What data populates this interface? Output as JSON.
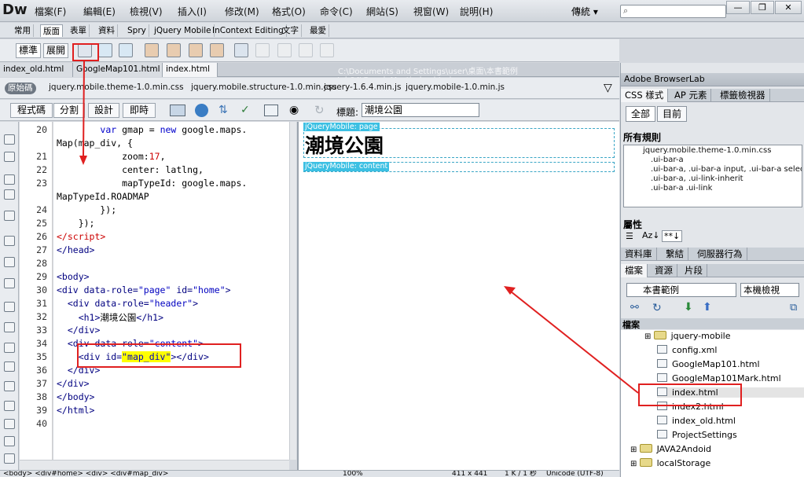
{
  "app": {
    "logo": "Dw",
    "layout": "傳統 ▾",
    "search_placeholder": ""
  },
  "menu": [
    "檔案(F)",
    "編輯(E)",
    "檢視(V)",
    "插入(I)",
    "修改(M)",
    "格式(O)",
    "命令(C)",
    "網站(S)",
    "視窗(W)",
    "說明(H)"
  ],
  "window_controls": [
    "—",
    "❐",
    "✕"
  ],
  "insert_tabs": [
    "常用",
    "版面",
    "表單",
    "資料",
    "Spry",
    "jQuery Mobile",
    "InContext Editing",
    "文字",
    "最愛"
  ],
  "insert_active": "版面",
  "layout_modes": [
    "標準",
    "展開"
  ],
  "doc_tabs": [
    "index_old.html",
    "GoogleMap101.html",
    "index.html"
  ],
  "doc_path": "C:\\Documents and Settings\\user\\桌面\\本書範例\\ch04\\GoogleMap\\index.html",
  "related": {
    "source_label": "原始碼",
    "files": [
      "jquery.mobile.theme-1.0.min.css",
      "jquery.mobile.structure-1.0.min.css",
      "jquery-1.6.4.min.js",
      "jquery.mobile-1.0.min.js"
    ]
  },
  "view_buttons": [
    "程式碼",
    "分割",
    "設計",
    "即時"
  ],
  "title_label": "標題:",
  "page_title": "潮境公園",
  "code_lines": [
    {
      "n": "20",
      "html": "        <span class='kw'>var</span> gmap = <span class='kw'>new</span> google.maps."
    },
    {
      "n": "",
      "html": "Map(map_div, {"
    },
    {
      "n": "21",
      "html": "            zoom:<span class='nm'>17</span>,"
    },
    {
      "n": "22",
      "html": "            center: latlng,"
    },
    {
      "n": "23",
      "html": "            mapTypeId: google.maps."
    },
    {
      "n": "",
      "html": "MapTypeId.ROADMAP"
    },
    {
      "n": "24",
      "html": "        });"
    },
    {
      "n": "25",
      "html": "    });"
    },
    {
      "n": "26",
      "html": "<span class='nm'>&lt;/script&gt;</span>"
    },
    {
      "n": "27",
      "html": "<span class='tg'>&lt;/head&gt;</span>"
    },
    {
      "n": "28",
      "html": ""
    },
    {
      "n": "29",
      "html": "<span class='tg'>&lt;body&gt;</span>"
    },
    {
      "n": "30",
      "html": "<span class='tg'>&lt;div data-role=</span><span class='st'>\"page\"</span><span class='tg'> id=</span><span class='st'>\"home\"</span><span class='tg'>&gt;</span>"
    },
    {
      "n": "31",
      "html": "  <span class='tg'>&lt;div data-role=</span><span class='st'>\"header\"</span><span class='tg'>&gt;</span>"
    },
    {
      "n": "32",
      "html": "    <span class='tg'>&lt;h1&gt;</span>潮境公園<span class='tg'>&lt;/h1&gt;</span>"
    },
    {
      "n": "33",
      "html": "  <span class='tg'>&lt;/div&gt;</span>"
    },
    {
      "n": "34",
      "html": "  <span class='tg'>&lt;div data-role=</span><span class='st'>\"content\"</span><span class='tg'>&gt;</span>"
    },
    {
      "n": "35",
      "html": "    <span class='tg'>&lt;div id=</span><span class='st' style='background:#ffff00'>\"map_div\"</span><span class='tg'>&gt;&lt;/div&gt;</span>"
    },
    {
      "n": "36",
      "html": "  <span class='tg'>&lt;/div&gt;</span>"
    },
    {
      "n": "37",
      "html": "<span class='tg'>&lt;/div&gt;</span>"
    },
    {
      "n": "38",
      "html": "<span class='tg'>&lt;/body&gt;</span>"
    },
    {
      "n": "39",
      "html": "<span class='tg'>&lt;/html&gt;</span>"
    },
    {
      "n": "40",
      "html": ""
    }
  ],
  "design": {
    "page_label": "jQueryMobile: page",
    "heading": "潮境公園",
    "content_label": "jQueryMobile: content"
  },
  "status": {
    "path": "<body> <div#home> <div> <div#map_div>",
    "zoom": "100%",
    "size": "411 x 441",
    "dl": "1 K / 1 秒",
    "enc": "Unicode (UTF-8)"
  },
  "panels": {
    "browserlab": "Adobe BrowserLab",
    "css_tabs": [
      "CSS 樣式",
      "AP 元素",
      "標籤檢視器"
    ],
    "mode_buttons": [
      "全部",
      "目前"
    ],
    "rules_title": "所有規則",
    "rules": [
      "jquery.mobile.theme-1.0.min.css",
      ".ui-bar-a",
      ".ui-bar-a, .ui-bar-a input, .ui-bar-a select",
      ".ui-bar-a, .ui-link-inherit",
      ".ui-bar-a .ui-link"
    ],
    "props_title": "屬性",
    "prop_icons": [
      "Az↓",
      "**↓"
    ],
    "db_tabs": [
      "資料庫",
      "繫結",
      "伺服器行為"
    ],
    "file_tabs": [
      "檔案",
      "資源",
      "片段"
    ],
    "site": "本書範例",
    "view": "本機檢視",
    "tree_header": "檔案",
    "tree": [
      {
        "label": "jquery-mobile",
        "type": "folder",
        "indent": 1,
        "expander": "+"
      },
      {
        "label": "config.xml",
        "type": "file",
        "indent": 2
      },
      {
        "label": "GoogleMap101.html",
        "type": "file",
        "indent": 2
      },
      {
        "label": "GoogleMap101Mark.html",
        "type": "file",
        "indent": 2
      },
      {
        "label": "index.html",
        "type": "file",
        "indent": 2,
        "selected": true
      },
      {
        "label": "index2.html",
        "type": "file",
        "indent": 2
      },
      {
        "label": "index_old.html",
        "type": "file",
        "indent": 2
      },
      {
        "label": "ProjectSettings",
        "type": "file",
        "indent": 2
      },
      {
        "label": "JAVA2Andoid",
        "type": "folder",
        "indent": 0,
        "expander": "+"
      },
      {
        "label": "localStorage",
        "type": "folder",
        "indent": 0,
        "expander": "+"
      }
    ]
  },
  "colors": {
    "annotation": "#e02020",
    "jqm_label": "#3cc0e3",
    "highlight": "#ffff00"
  }
}
